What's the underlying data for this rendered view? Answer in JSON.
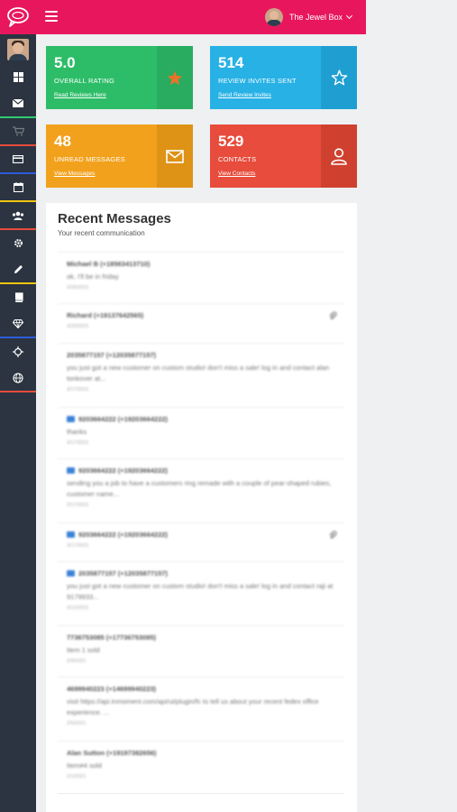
{
  "topbar": {
    "user_name": "The Jewel Box"
  },
  "cards": {
    "rating": {
      "value": "5.0",
      "label": "OVERALL RATING",
      "link": "Read Reviews Here",
      "icon": "star-icon"
    },
    "invites": {
      "value": "514",
      "label": "REVIEW INVITES SENT",
      "link": "Send Review Invites",
      "icon": "star-outline-icon"
    },
    "unread": {
      "value": "48",
      "label": "UNREAD MESSAGES",
      "link": "View Messages",
      "icon": "envelope-icon"
    },
    "contacts": {
      "value": "529",
      "label": "CONTACTS",
      "link": "View Contacts",
      "icon": "user-icon"
    }
  },
  "messages_panel": {
    "title": "Recent Messages",
    "subtitle": "Your recent communication",
    "items": [
      {
        "from": "Michael B (+18563413710)",
        "body": "ok, I'll be in friday",
        "time": "3/20/2021"
      },
      {
        "from": "Richard (+19137642565)",
        "body": "",
        "time": "3/20/2021"
      },
      {
        "from": "2035877157 (+12035877157)",
        "body": "you just got a new customer on custom studio! don't miss a sale! log in and contact alan tonkover at...",
        "time": "3/17/2021"
      },
      {
        "from": "9203664222 (+19203664222)",
        "body": "thanks",
        "time": "3/17/2021"
      },
      {
        "from": "9203664222 (+19203664222)",
        "body": "sending you a job to have a customers ring remade with a couple of pear-shaped rubies, customer name...",
        "time": "3/17/2021"
      },
      {
        "from": "9203664222 (+19203664222)",
        "body": "",
        "time": "3/17/2021"
      },
      {
        "from": "2035877157 (+12035877157)",
        "body": "you just got a new customer on custom studio! don't miss a sale! log in and contact raji at 9179933...",
        "time": "3/12/2021"
      },
      {
        "from": "7736753085 (+17736753085)",
        "body": "Item 1 sold",
        "time": "2/9/2021"
      },
      {
        "from": "4699940223 (+14699940223)",
        "body": "visit https://api.inmoment.com/api/ui/plugin/fc to tell us about your recent fedex office experience. ...",
        "time": "2/5/2021"
      },
      {
        "from": "Alan Sutton (+19197382656)",
        "body": "Item#4 sold",
        "time": "2/1/2021"
      }
    ]
  }
}
